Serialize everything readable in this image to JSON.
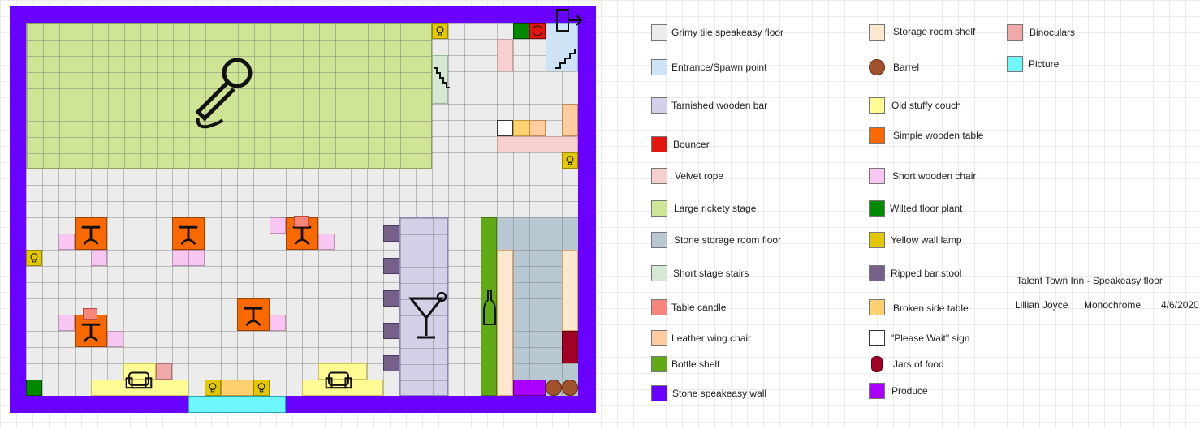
{
  "colors": {
    "floor": "#ececec",
    "entrance": "#cfe3f7",
    "bar": "#d3d0e8",
    "bouncer": "#e0160f",
    "rope": "#f8cfcf",
    "stage": "#cfe596",
    "storage_floor": "#b8c8d2",
    "stairs": "#d5e8d4",
    "candle": "#f8857b",
    "wing_chair": "#fdcda1",
    "bottle_shelf": "#60a917",
    "wall": "#6a00ff",
    "storage_shelf": "#fde7cf",
    "barrel": "#a0522d",
    "couch": "#fffb94",
    "table": "#fa6800",
    "short_chair": "#f8c6f0",
    "plant": "#008a00",
    "lamp": "#e3c800",
    "stool": "#76608a",
    "side_table": "#fdd170",
    "sign": "#ffffff",
    "jars": "#a20025",
    "produce": "#aa00ff",
    "binoculars": "#f0a9a9",
    "picture": "#6ff7ff"
  },
  "icons": {
    "stage": "microphone-icon",
    "bar": "cocktail-glass-icon",
    "bottle_shelf": "bottle-icon",
    "entrance": "exit-door-icon",
    "stairs": "stairs-icon",
    "lamp": "light-bulb-icon",
    "couch": "armchair-icon",
    "bouncer": "shield-icon",
    "barrel": "barrel-icon"
  },
  "legend": [
    {
      "key": "floor",
      "label": "Grimy tile speakeasy floor"
    },
    {
      "key": "entrance",
      "label": "Entrance/Spawn point"
    },
    {
      "key": "bar",
      "label": "Tarnished wooden bar"
    },
    {
      "key": "bouncer",
      "label": "Bouncer"
    },
    {
      "key": "rope",
      "label": "Velvet rope"
    },
    {
      "key": "stage",
      "label": "Large rickety stage"
    },
    {
      "key": "storage_floor",
      "label": "Stone storage room floor"
    },
    {
      "key": "stairs",
      "label": "Short stage stairs"
    },
    {
      "key": "candle",
      "label": "Table candle"
    },
    {
      "key": "wing_chair",
      "label": "Leather wing chair"
    },
    {
      "key": "bottle_shelf",
      "label": "Bottle shelf"
    },
    {
      "key": "wall",
      "label": "Stone speakeasy wall"
    },
    {
      "key": "storage_shelf",
      "label": "Storage room shelf"
    },
    {
      "key": "barrel",
      "label": "Barrel"
    },
    {
      "key": "couch",
      "label": "Old stuffy couch"
    },
    {
      "key": "table",
      "label": "Simple wooden table"
    },
    {
      "key": "short_chair",
      "label": "Short wooden chair"
    },
    {
      "key": "plant",
      "label": "Wilted floor plant"
    },
    {
      "key": "lamp",
      "label": "Yellow wall lamp"
    },
    {
      "key": "stool",
      "label": "Ripped bar stool"
    },
    {
      "key": "side_table",
      "label": "Broken side table"
    },
    {
      "key": "sign",
      "label": "\"Please Wait\" sign"
    },
    {
      "key": "jars",
      "label": "Jars of food"
    },
    {
      "key": "produce",
      "label": "Produce"
    },
    {
      "key": "binoculars",
      "label": "Binoculars"
    },
    {
      "key": "picture",
      "label": "Picture"
    }
  ],
  "meta": {
    "title": "Talent Town Inn - Speakeasy floor",
    "author": "Lillian Joyce",
    "style": "Monochrome",
    "date": "4/6/2020"
  }
}
